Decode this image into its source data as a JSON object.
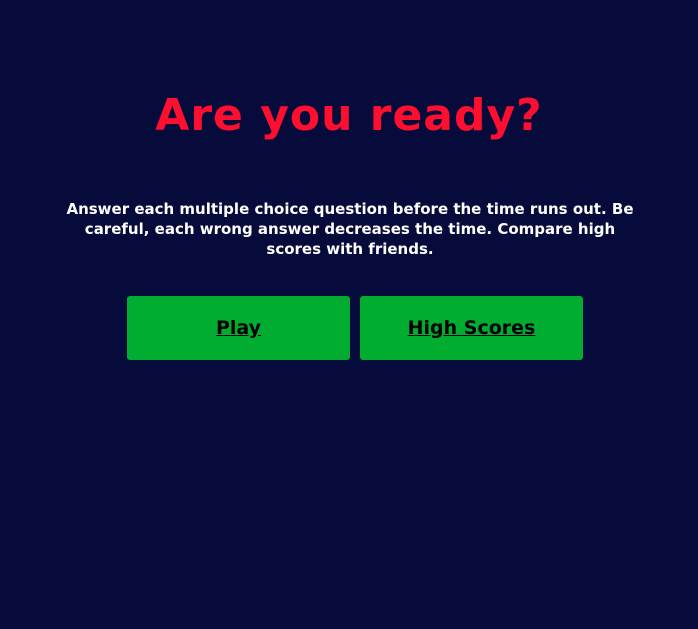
{
  "title": "Are you ready?",
  "description": "Answer each multiple choice question before the time runs out. Be careful, each wrong answer decreases the time. Compare high scores with friends.",
  "buttons": {
    "play": "Play",
    "high_scores": "High Scores"
  },
  "colors": {
    "background": "#070b3b",
    "title": "#ff0f2f",
    "button": "#00ad30",
    "text": "#ffffff"
  }
}
